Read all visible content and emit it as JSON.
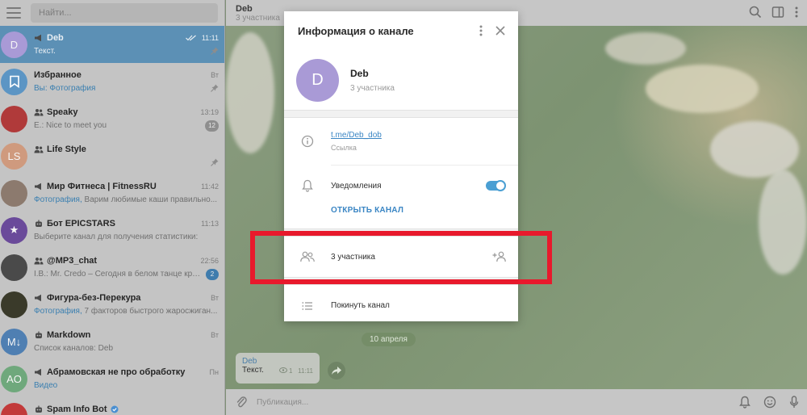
{
  "sidebar": {
    "search_placeholder": "Найти...",
    "chats": [
      {
        "avatar_text": "D",
        "avatar_color": "#a99ad6",
        "title": "Deb",
        "type": "channel",
        "time": "11:11",
        "preview_hl": "",
        "preview": "Текст.",
        "pinned": true,
        "active": true,
        "read": true
      },
      {
        "avatar_text": "",
        "avatar_color": "#5c95c4",
        "title": "Избранное",
        "type": "saved",
        "time": "Вт",
        "preview_hl": "Вы: Фотография",
        "preview": "",
        "pinned": true
      },
      {
        "avatar_text": "",
        "avatar_color": "#b03a3a",
        "title": "Speaky",
        "type": "group",
        "time": "13:19",
        "preview_hl": "",
        "preview": "E.: Nice to meet you",
        "badge": "12"
      },
      {
        "avatar_text": "LS",
        "avatar_color": "#cf9a7e",
        "title": "Life Style",
        "type": "group",
        "time": "",
        "preview_hl": "",
        "preview": "",
        "pinned": true
      },
      {
        "avatar_text": "",
        "avatar_color": "#8c7a6e",
        "title": "Мир Фитнеса | FitnessRU",
        "type": "channel",
        "time": "11:42",
        "preview_hl": "Фотография, ",
        "preview": "Варим любимые каши правильно..."
      },
      {
        "avatar_text": "★",
        "avatar_color": "#6a4a9a",
        "title": "Бот EPICSTARS",
        "type": "bot",
        "time": "11:13",
        "preview_hl": "",
        "preview": "Выберите канал для получения статистики:"
      },
      {
        "avatar_text": "",
        "avatar_color": "#4a4a4a",
        "title": "@MP3_chat",
        "type": "group",
        "time": "22:56",
        "preview_hl": "",
        "preview": "I.B.: Mr. Credo – Сегодня в белом танце круж...",
        "badge": "2",
        "badge_blue": true
      },
      {
        "avatar_text": "",
        "avatar_color": "#3a3a2a",
        "title": "Фигура-без-Перекура",
        "type": "channel",
        "time": "Вт",
        "preview_hl": "Фотография, ",
        "preview": "7 факторов быстрого жаросжиган..."
      },
      {
        "avatar_text": "M↓",
        "avatar_color": "#4f7fb2",
        "title": "Markdown",
        "type": "bot",
        "time": "Вт",
        "preview_hl": "",
        "preview": "Список каналов:   Deb"
      },
      {
        "avatar_text": "AO",
        "avatar_color": "#6fa87c",
        "title": "Абрамовская не про обработку",
        "type": "channel",
        "time": "Пн",
        "preview_hl": "Видео",
        "preview": ""
      },
      {
        "avatar_text": "",
        "avatar_color": "#c23a3a",
        "title": "Spam Info Bot",
        "type": "bot",
        "time": "",
        "preview_hl": "",
        "preview": "",
        "verified": true
      }
    ]
  },
  "main": {
    "title": "Deb",
    "subtitle": "3 участника",
    "date_pill": "10 апреля",
    "message": {
      "author": "Deb",
      "text": "Текст.",
      "views": "1",
      "time": "11:11"
    },
    "composer_placeholder": "Публикация..."
  },
  "modal": {
    "title": "Информация о канале",
    "name": "Deb",
    "member_count": "3 участника",
    "link": "t.me/Deb_dob",
    "link_label": "Ссылка",
    "notifications_label": "Уведомления",
    "notifications_on": true,
    "open_channel": "ОТКРЫТЬ КАНАЛ",
    "members_label": "3 участника",
    "leave_label": "Покинуть канал"
  },
  "colors": {
    "accent": "#4a9fd3",
    "active_chat": "#5c90b5",
    "highlight": "#e8192c",
    "avatar": "#a99ad6"
  }
}
